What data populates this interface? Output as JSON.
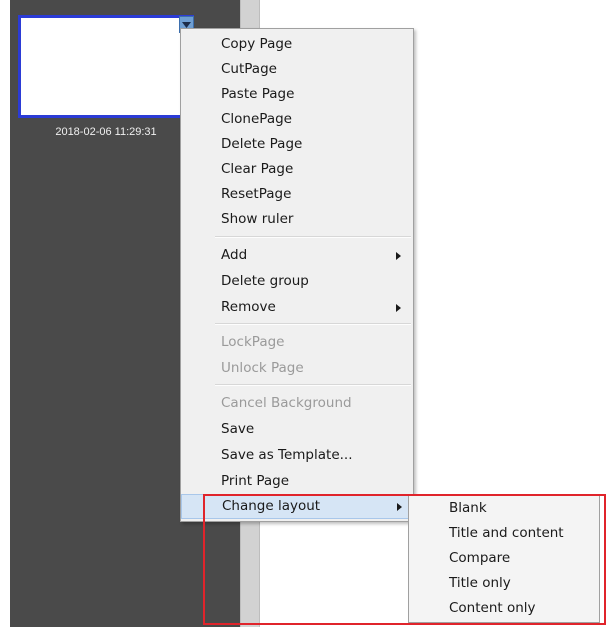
{
  "thumbnail": {
    "caption": "2018-02-06 11:29:31"
  },
  "menu": {
    "items": [
      {
        "label": "Copy Page",
        "enabled": true
      },
      {
        "label": "CutPage",
        "enabled": true
      },
      {
        "label": "Paste Page",
        "enabled": true
      },
      {
        "label": "ClonePage",
        "enabled": true
      },
      {
        "label": "Delete Page",
        "enabled": true
      },
      {
        "label": "Clear Page",
        "enabled": true
      },
      {
        "label": "ResetPage",
        "enabled": true
      },
      {
        "label": "Show ruler",
        "enabled": true
      },
      {
        "label": "Add",
        "enabled": true,
        "has_submenu": true
      },
      {
        "label": "Delete group",
        "enabled": true
      },
      {
        "label": "Remove",
        "enabled": true,
        "has_submenu": true
      },
      {
        "label": "LockPage",
        "enabled": false
      },
      {
        "label": "Unlock Page",
        "enabled": false
      },
      {
        "label": "Cancel Background",
        "enabled": false
      },
      {
        "label": "Save",
        "enabled": true
      },
      {
        "label": "Save as Template...",
        "enabled": true
      },
      {
        "label": "Print Page",
        "enabled": true
      },
      {
        "label": "Change layout",
        "enabled": true,
        "has_submenu": true,
        "active": true
      }
    ]
  },
  "submenu": {
    "items": [
      {
        "label": "Blank"
      },
      {
        "label": "Title and content"
      },
      {
        "label": "Compare"
      },
      {
        "label": "Title only"
      },
      {
        "label": "Content only"
      }
    ]
  },
  "colors": {
    "highlight_border": "#e0242b",
    "thumbnail_border": "#2b3bd6",
    "panel_bg": "#4a4a4a"
  },
  "icons": {
    "dropdown": "triangle-down-icon",
    "submenu": "triangle-right-icon"
  }
}
